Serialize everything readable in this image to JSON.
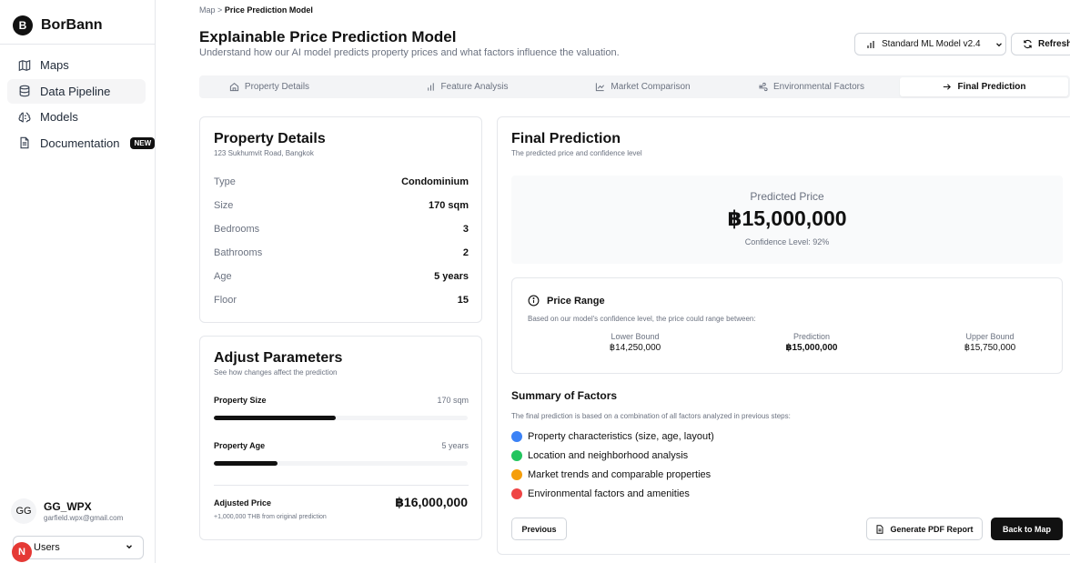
{
  "brand": {
    "logo_letter": "B",
    "name": "BorBann"
  },
  "sidebar": {
    "items": [
      {
        "label": "Maps",
        "icon": "map-icon"
      },
      {
        "label": "Data Pipeline",
        "icon": "database-icon",
        "active": true
      },
      {
        "label": "Models",
        "icon": "brain-icon"
      },
      {
        "label": "Documentation",
        "icon": "document-icon",
        "badge": "NEW"
      }
    ],
    "user": {
      "initials": "GG",
      "name": "GG_WPX",
      "email": "garfield.wpx@gmail.com"
    },
    "role_select": "Users",
    "notification_letter": "N"
  },
  "header": {
    "breadcrumb_root": "Map",
    "breadcrumb_sep": ">",
    "breadcrumb_current": "Price Prediction Model",
    "title": "Explainable Price Prediction Model",
    "subtitle": "Understand how our AI model predicts property prices and what factors influence the valuation.",
    "model_select": "Standard ML Model v2.4",
    "refresh_label": "Refresh"
  },
  "tabs": [
    {
      "label": "Property Details",
      "icon": "home-icon"
    },
    {
      "label": "Feature Analysis",
      "icon": "bar-chart-icon"
    },
    {
      "label": "Market Comparison",
      "icon": "line-chart-icon"
    },
    {
      "label": "Environmental Factors",
      "icon": "wind-icon"
    },
    {
      "label": "Final Prediction",
      "icon": "arrow-right-icon",
      "active": true
    }
  ],
  "property": {
    "title": "Property Details",
    "address": "123 Sukhumvit Road, Bangkok",
    "rows": [
      {
        "key": "Type",
        "value": "Condominium"
      },
      {
        "key": "Size",
        "value": "170 sqm"
      },
      {
        "key": "Bedrooms",
        "value": "3"
      },
      {
        "key": "Bathrooms",
        "value": "2"
      },
      {
        "key": "Age",
        "value": "5 years"
      },
      {
        "key": "Floor",
        "value": "15"
      }
    ]
  },
  "adjust": {
    "title": "Adjust Parameters",
    "subtitle": "See how changes affect the prediction",
    "size_label": "Property Size",
    "size_value": "170 sqm",
    "size_fill": 0.48,
    "age_label": "Property Age",
    "age_value": "5 years",
    "age_fill": 0.25,
    "price_label": "Adjusted Price",
    "price_value": "฿16,000,000",
    "price_note": "+1,000,000 THB from original prediction"
  },
  "final": {
    "title": "Final Prediction",
    "subtitle": "The predicted price and confidence level",
    "predicted_label": "Predicted Price",
    "predicted_value": "฿15,000,000",
    "confidence": "Confidence Level: 92%",
    "range": {
      "title": "Price Range",
      "desc": "Based on our model's confidence level, the price could range between:",
      "lower_label": "Lower Bound",
      "lower_value": "฿14,250,000",
      "pred_label": "Prediction",
      "pred_value": "฿15,000,000",
      "upper_label": "Upper Bound",
      "upper_value": "฿15,750,000"
    },
    "summary_title": "Summary of Factors",
    "summary_desc": "The final prediction is based on a combination of all factors analyzed in previous steps:",
    "factors": [
      {
        "label": "Property characteristics (size, age, layout)",
        "color": "#3b82f6"
      },
      {
        "label": "Location and neighborhood analysis",
        "color": "#22c55e"
      },
      {
        "label": "Market trends and comparable properties",
        "color": "#f59e0b"
      },
      {
        "label": "Environmental factors and amenities",
        "color": "#ef4444"
      }
    ],
    "previous_label": "Previous",
    "pdf_label": "Generate PDF Report",
    "back_label": "Back to Map"
  }
}
